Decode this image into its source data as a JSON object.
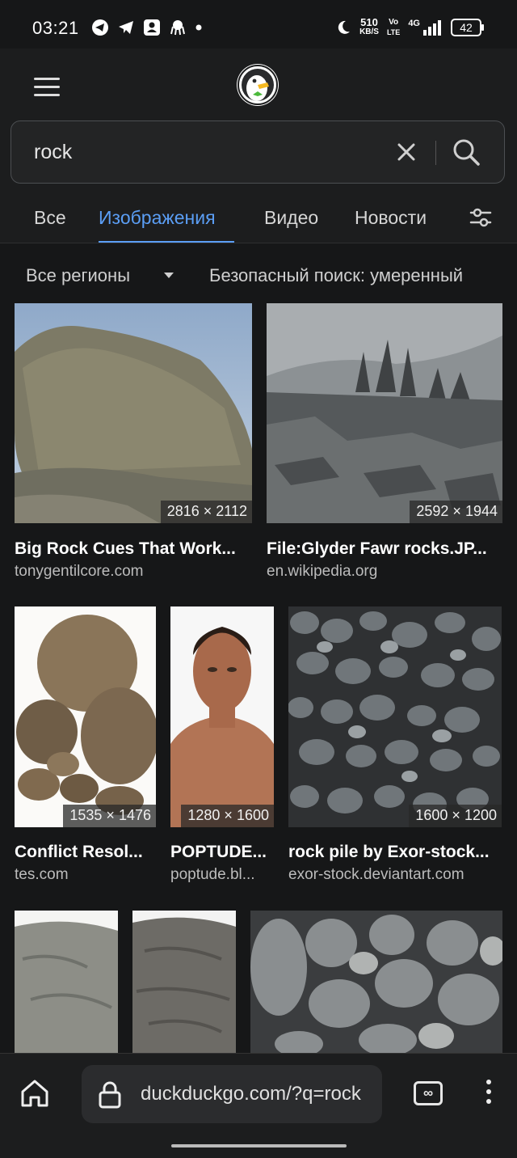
{
  "status_bar": {
    "time": "03:21",
    "net_speed_value": "510",
    "net_speed_unit": "KB/S",
    "volte_top": "Vo",
    "volte_bottom": "LTE",
    "network": "4G",
    "battery": "42"
  },
  "search": {
    "query": "rock"
  },
  "tabs": [
    {
      "label": "Все",
      "active": false
    },
    {
      "label": "Изображения",
      "active": true
    },
    {
      "label": "Видео",
      "active": false
    },
    {
      "label": "Новости",
      "active": false
    }
  ],
  "filters": {
    "region": "Все регионы",
    "safe_search": "Безопасный поиск: умеренный"
  },
  "results": [
    {
      "title": "Big Rock Cues That Work...",
      "source": "tonygentilcore.com",
      "dims": "2816 × 2112"
    },
    {
      "title": "File:Glyder Fawr rocks.JP...",
      "source": "en.wikipedia.org",
      "dims": "2592 × 1944"
    },
    {
      "title": "Conflict Resol...",
      "source": "tes.com",
      "dims": "1535 × 1476"
    },
    {
      "title": "POPTUDE...",
      "source": "poptude.bl...",
      "dims": "1280 × 1600"
    },
    {
      "title": "rock pile by Exor-stock...",
      "source": "exor-stock.deviantart.com",
      "dims": "1600 × 1200"
    }
  ],
  "browser": {
    "url": "duckduckgo.com/?q=rock"
  },
  "colors": {
    "accent": "#5b9ef5",
    "background": "#161718"
  }
}
